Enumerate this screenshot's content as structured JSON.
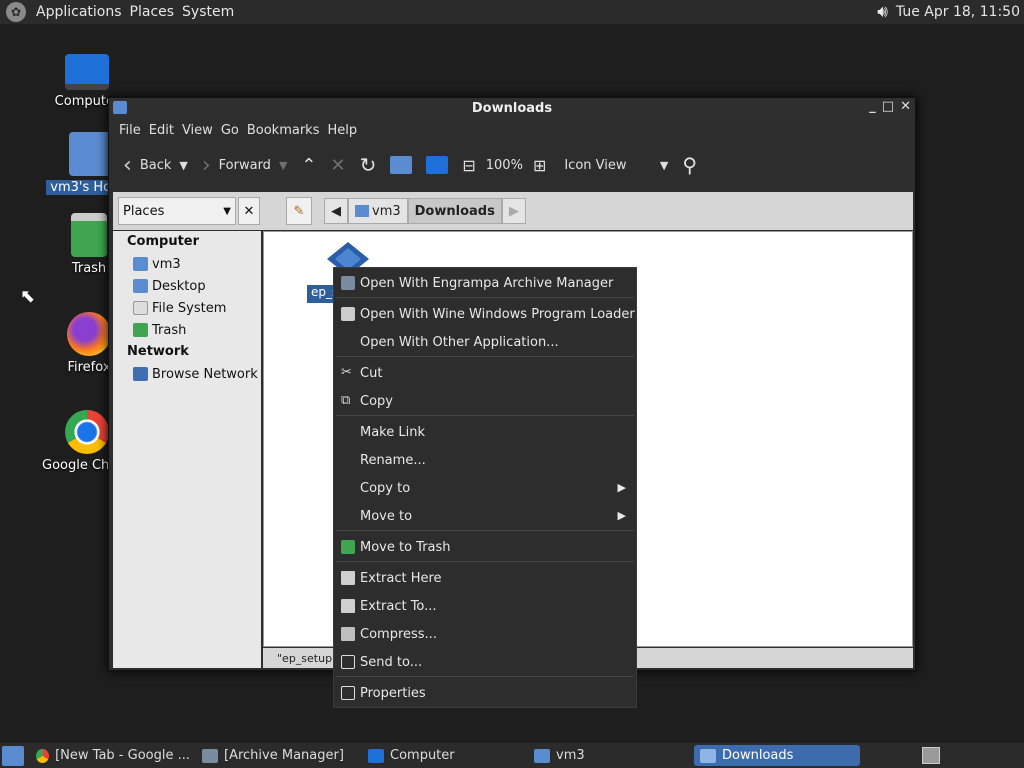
{
  "topbar": {
    "applications": "Applications",
    "places": "Places",
    "system": "System",
    "datetime": "Tue Apr 18, 11:50"
  },
  "desktop": {
    "icons": [
      {
        "label": "Computer"
      },
      {
        "label": "vm3's Home"
      },
      {
        "label": "Trash"
      },
      {
        "label": "Firefox"
      },
      {
        "label": "Google Chrome"
      }
    ]
  },
  "window": {
    "title": "Downloads",
    "menubar": [
      "File",
      "Edit",
      "View",
      "Go",
      "Bookmarks",
      "Help"
    ],
    "toolbar": {
      "back": "Back",
      "forward": "Forward",
      "zoom": "100%",
      "view": "Icon View"
    },
    "places_select": "Places",
    "breadcrumbs": [
      "vm3",
      "Downloads"
    ],
    "sidebar": {
      "computer_heading": "Computer",
      "computer_items": [
        "vm3",
        "Desktop",
        "File System",
        "Trash"
      ],
      "network_heading": "Network",
      "network_items": [
        "Browse Network"
      ]
    },
    "file_label": "ep_s",
    "status": "\"ep_setup.e"
  },
  "context_menu": {
    "items": [
      "Open With Engrampa Archive Manager",
      "Open With Wine Windows Program Loader",
      "Open With Other Application...",
      "Cut",
      "Copy",
      "Make Link",
      "Rename...",
      "Copy to",
      "Move to",
      "Move to Trash",
      "Extract Here",
      "Extract To...",
      "Compress...",
      "Send to...",
      "Properties"
    ]
  },
  "taskbar": {
    "tasks": [
      "[New Tab - Google ...",
      "[Archive Manager]",
      "Computer",
      "vm3",
      "Downloads"
    ]
  },
  "colors": {
    "accent": "#3d6cae",
    "menu_bg": "#2d2d2d",
    "desktop_bg": "#1e1e1e"
  }
}
